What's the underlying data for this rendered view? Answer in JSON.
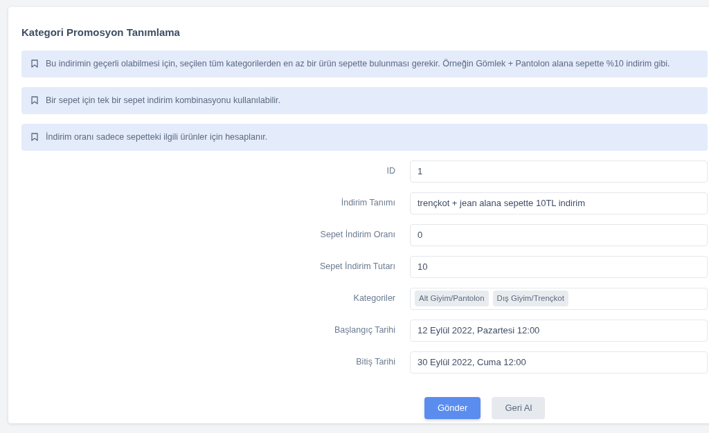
{
  "title": "Kategori Promosyon Tanımlama",
  "notes": [
    "Bu indirimin geçerli olabilmesi için, seçilen tüm kategorilerden en az bir ürün sepette bulunması gerekir. Örneğin Gömlek + Pantolon alana sepette %10 indirim gibi.",
    "Bir sepet için tek bir sepet indirim kombinasyonu kullanılabilir.",
    "İndirim oranı sadece sepetteki ilgili ürünler için hesaplanır."
  ],
  "fields": [
    {
      "kind": "text",
      "label": "ID",
      "value": "1"
    },
    {
      "kind": "text",
      "label": "İndirim Tanımı",
      "value": "trençkot + jean alana sepette 10TL indirim"
    },
    {
      "kind": "text",
      "label": "Sepet İndirim Oranı",
      "value": "0"
    },
    {
      "kind": "text",
      "label": "Sepet İndirim Tutarı",
      "value": "10"
    },
    {
      "kind": "tags",
      "label": "Kategoriler",
      "tags": [
        "Alt Giyim/Pantolon",
        "Dış Giyim/Trençkot"
      ]
    },
    {
      "kind": "text",
      "label": "Başlangıç Tarihi",
      "value": "12 Eylül 2022, Pazartesi 12:00"
    },
    {
      "kind": "text",
      "label": "Bitiş Tarihi",
      "value": "30 Eylül 2022, Cuma 12:00"
    }
  ],
  "buttons": [
    {
      "kind": "primary",
      "label": "Gönder"
    },
    {
      "kind": "secondary",
      "label": "Geri Al"
    }
  ]
}
